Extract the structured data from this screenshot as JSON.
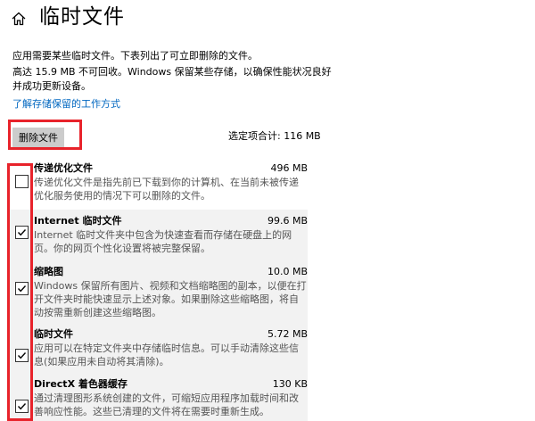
{
  "header": {
    "title": "临时文件",
    "home_icon": "home-icon"
  },
  "intro": {
    "line1": "应用需要某些临时文件。下表列出了可立即删除的文件。",
    "line2": "高达 15.9 MB 不可回收。Windows 保留某些存储，以确保性能状况良好并成功更新设备。",
    "learn_link": "了解存储保留的工作方式"
  },
  "actions": {
    "delete_label": "删除文件",
    "selected_total": "选定项合计: 116 MB"
  },
  "items": [
    {
      "title": "传递优化文件",
      "size": "496 MB",
      "checked": false,
      "desc": "传递优化文件是指先前已下载到你的计算机、在当前未被传递优化服务使用的情况下可以删除的文件。"
    },
    {
      "title": "Internet 临时文件",
      "size": "99.6 MB",
      "checked": true,
      "desc": "Internet 临时文件夹中包含为快速查看而存储在硬盘上的网页。你的网页个性化设置将被完整保留。"
    },
    {
      "title": "缩略图",
      "size": "10.0 MB",
      "checked": true,
      "desc": "Windows 保留所有图片、视频和文档缩略图的副本，以便在打开文件夹时能快速显示上述对象。如果删除这些缩略图，将自动按需重新创建这些缩略图。"
    },
    {
      "title": "临时文件",
      "size": "5.72 MB",
      "checked": true,
      "desc": "应用可以在特定文件夹中存储临时信息。可以手动清除这些信息(如果应用未自动将其清除)。"
    },
    {
      "title": "DirectX 着色器缓存",
      "size": "130 KB",
      "checked": true,
      "desc": "通过清理图形系统创建的文件，可缩短应用程序加载时间和改善响应性能。这些已清理的文件将在需要时重新生成。"
    }
  ],
  "colors": {
    "accent": "#0067c0",
    "highlight": "#e8232b"
  }
}
